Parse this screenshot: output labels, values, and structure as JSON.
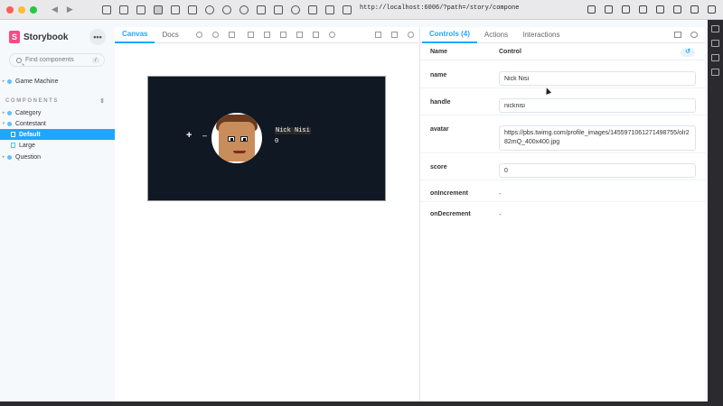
{
  "browser": {
    "url": "http://localhost:6006/?path=/story/compone"
  },
  "sidebar": {
    "logo_mark": "S",
    "logo_text": "Storybook",
    "more_label": "•••",
    "search_placeholder": "Find components",
    "search_shortcut": "/",
    "top_items": [
      {
        "label": "Game Machine"
      }
    ],
    "section_title": "COMPONENTS",
    "tree": [
      {
        "label": "Category"
      },
      {
        "label": "Contestant"
      },
      {
        "label": "Default",
        "selected": true
      },
      {
        "label": "Large"
      },
      {
        "label": "Question"
      }
    ]
  },
  "preview": {
    "tabs": [
      {
        "label": "Canvas",
        "active": true
      },
      {
        "label": "Docs"
      }
    ],
    "component": {
      "name": "Nick Nisi",
      "score": "0",
      "increment_glyph": "+",
      "decrement_glyph": "–"
    }
  },
  "addons": {
    "tabs": [
      {
        "label": "Controls (4)",
        "active": true
      },
      {
        "label": "Actions"
      },
      {
        "label": "Interactions"
      }
    ],
    "header": {
      "name": "Name",
      "control": "Control",
      "reset": "↺"
    },
    "controls": [
      {
        "name": "name",
        "value": "Nick Nisi"
      },
      {
        "name": "handle",
        "value": "nicknisi"
      },
      {
        "name": "avatar",
        "value": "https://pbs.twimg.com/profile_images/1455971061271498755/olr282mQ_400x400.jpg"
      },
      {
        "name": "score",
        "value": "0"
      },
      {
        "name": "onIncrement",
        "value": "-"
      },
      {
        "name": "onDecrement",
        "value": "-"
      }
    ]
  },
  "colors": {
    "accent": "#1ea7fd",
    "brand": "#ff4785",
    "canvas_bg": "#101823"
  }
}
